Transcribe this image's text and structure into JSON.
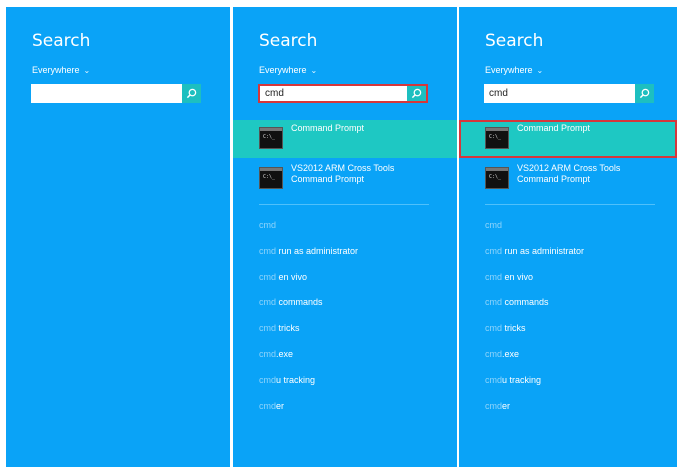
{
  "panels": [
    {
      "title": "Search",
      "scope": "Everywhere",
      "query": "",
      "results": [],
      "suggestions": []
    },
    {
      "title": "Search",
      "scope": "Everywhere",
      "query": "cmd",
      "results": [
        {
          "label": "Command Prompt",
          "label2": ""
        },
        {
          "label": "VS2012 ARM Cross Tools",
          "label2": "Command Prompt"
        }
      ],
      "suggestions": [
        {
          "q": "cmd",
          "rest": ""
        },
        {
          "q": "cmd",
          "rest": " run as administrator"
        },
        {
          "q": "cmd",
          "rest": " en vivo"
        },
        {
          "q": "cmd",
          "rest": " commands"
        },
        {
          "q": "cmd",
          "rest": " tricks"
        },
        {
          "q": "cmd",
          "rest": ".exe"
        },
        {
          "q": "cmd",
          "rest": "u tracking"
        },
        {
          "q": "cmd",
          "rest": "er"
        }
      ]
    },
    {
      "title": "Search",
      "scope": "Everywhere",
      "query": "cmd",
      "results": [
        {
          "label": "Command Prompt",
          "label2": ""
        },
        {
          "label": "VS2012 ARM Cross Tools",
          "label2": "Command Prompt"
        }
      ],
      "suggestions": [
        {
          "q": "cmd",
          "rest": ""
        },
        {
          "q": "cmd",
          "rest": " run as administrator"
        },
        {
          "q": "cmd",
          "rest": " en vivo"
        },
        {
          "q": "cmd",
          "rest": " commands"
        },
        {
          "q": "cmd",
          "rest": " tricks"
        },
        {
          "q": "cmd",
          "rest": ".exe"
        },
        {
          "q": "cmd",
          "rest": "u tracking"
        },
        {
          "q": "cmd",
          "rest": "er"
        }
      ]
    }
  ],
  "colors": {
    "panel_bg": "#0aa3f7",
    "highlight": "#1ec8c3",
    "search_button": "#1dbfc0",
    "annotation_red": "#d6373b"
  },
  "icons": {
    "search_button_icon": "magnifier-icon",
    "app_icon": "command-prompt-icon",
    "scope_chevron": "chevron-down-icon"
  }
}
